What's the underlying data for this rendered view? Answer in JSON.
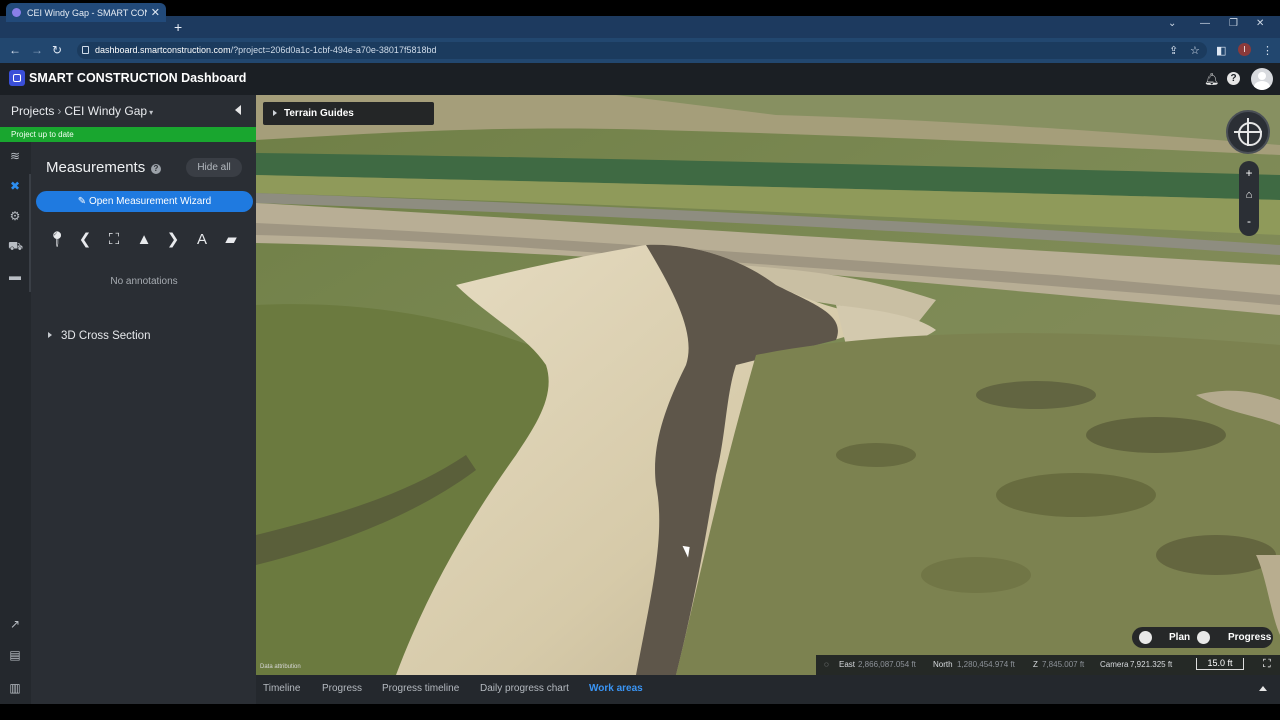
{
  "browser": {
    "tab_title": "CEI Windy Gap - SMART CONSTR",
    "tab_close": "✕",
    "new_tab": "+",
    "url_host": "dashboard.smartconstruction.com",
    "url_path": "/?project=206d0a1c-1cbf-494e-a70e-38017f5818bd",
    "profile_initial": "I"
  },
  "app": {
    "title": "SMART CONSTRUCTION Dashboard"
  },
  "sidebar": {
    "breadcrumb_root": "Projects",
    "breadcrumb_sep": "›",
    "project_name": "CEI Windy Gap",
    "project_caret": "▾",
    "status": "Project up to date",
    "measurements_title": "Measurements",
    "help": "?",
    "hide_all": "Hide all",
    "wizard_label": "Open Measurement Wizard",
    "wizard_icon": "✎",
    "no_annotations": "No annotations",
    "cross_section": "3D Cross Section"
  },
  "viewport": {
    "terrain_guides": "Terrain Guides",
    "zoom_in": "+",
    "zoom_out": "-",
    "attribution": "Data attribution",
    "plan_label": "Plan",
    "progress_label": "Progress",
    "east_label": "East",
    "east_value": "2,866,087.054 ft",
    "north_label": "North",
    "north_value": "1,280,454.974 ft",
    "z_label": "Z",
    "z_value": "7,845.007 ft",
    "camera_label": "Camera",
    "camera_value": "7,921.325 ft",
    "scale": "15.0 ft"
  },
  "bottom_tabs": [
    {
      "label": "Timeline"
    },
    {
      "label": "Progress"
    },
    {
      "label": "Progress timeline"
    },
    {
      "label": "Daily progress chart"
    },
    {
      "label": "Work areas"
    }
  ],
  "colors": {
    "accent": "#1f7ae0",
    "status_green": "#19a62f",
    "active_tab": "#3a95f5"
  }
}
